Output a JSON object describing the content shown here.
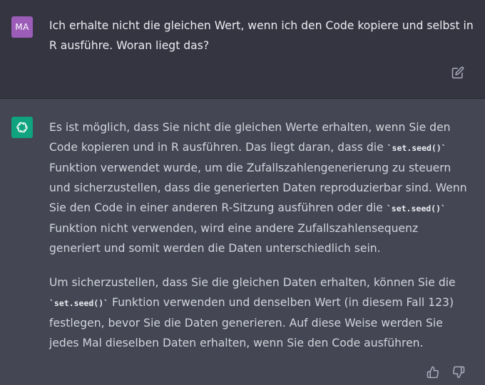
{
  "user_message": {
    "avatar_initials": "MA",
    "avatar_color": "#9c5db8",
    "text": "Ich erhalte nicht die gleichen Wert, wenn ich den Code kopiere und selbst in R ausführe. Woran liegt das?"
  },
  "assistant_message": {
    "avatar_color": "#10a37f",
    "avatar_icon": "openai-logo-icon",
    "paragraph1": {
      "part1": "Es ist möglich, dass Sie nicht die gleichen Werte erhalten, wenn Sie den Code kopieren und in R ausführen. Das liegt daran, dass die ",
      "code1": "`set.seed()`",
      "part2": " Funktion verwendet wurde, um die Zufallszahlengenerierung zu steuern und sicherzustellen, dass die generierten Daten reproduzierbar sind. Wenn Sie den Code in einer anderen R-Sitzung ausführen oder die ",
      "code2": "`set.seed()`",
      "part3": " Funktion nicht verwenden, wird eine andere Zufallszahlensequenz generiert und somit werden die Daten unterschiedlich sein."
    },
    "paragraph2": {
      "part1": "Um sicherzustellen, dass Sie die gleichen Daten erhalten, können Sie die ",
      "code1": "`set.seed()`",
      "part2": " Funktion verwenden und denselben Wert (in diesem Fall 123) festlegen, bevor Sie die Daten generieren. Auf diese Weise werden Sie jedes Mal dieselben Daten erhalten, wenn Sie den Code ausführen."
    }
  },
  "icons": {
    "edit": "edit-icon",
    "thumbs_up": "thumbs-up-icon",
    "thumbs_down": "thumbs-down-icon"
  },
  "colors": {
    "user_bg": "#343541",
    "assistant_bg": "#444654",
    "text": "#ececf1"
  }
}
